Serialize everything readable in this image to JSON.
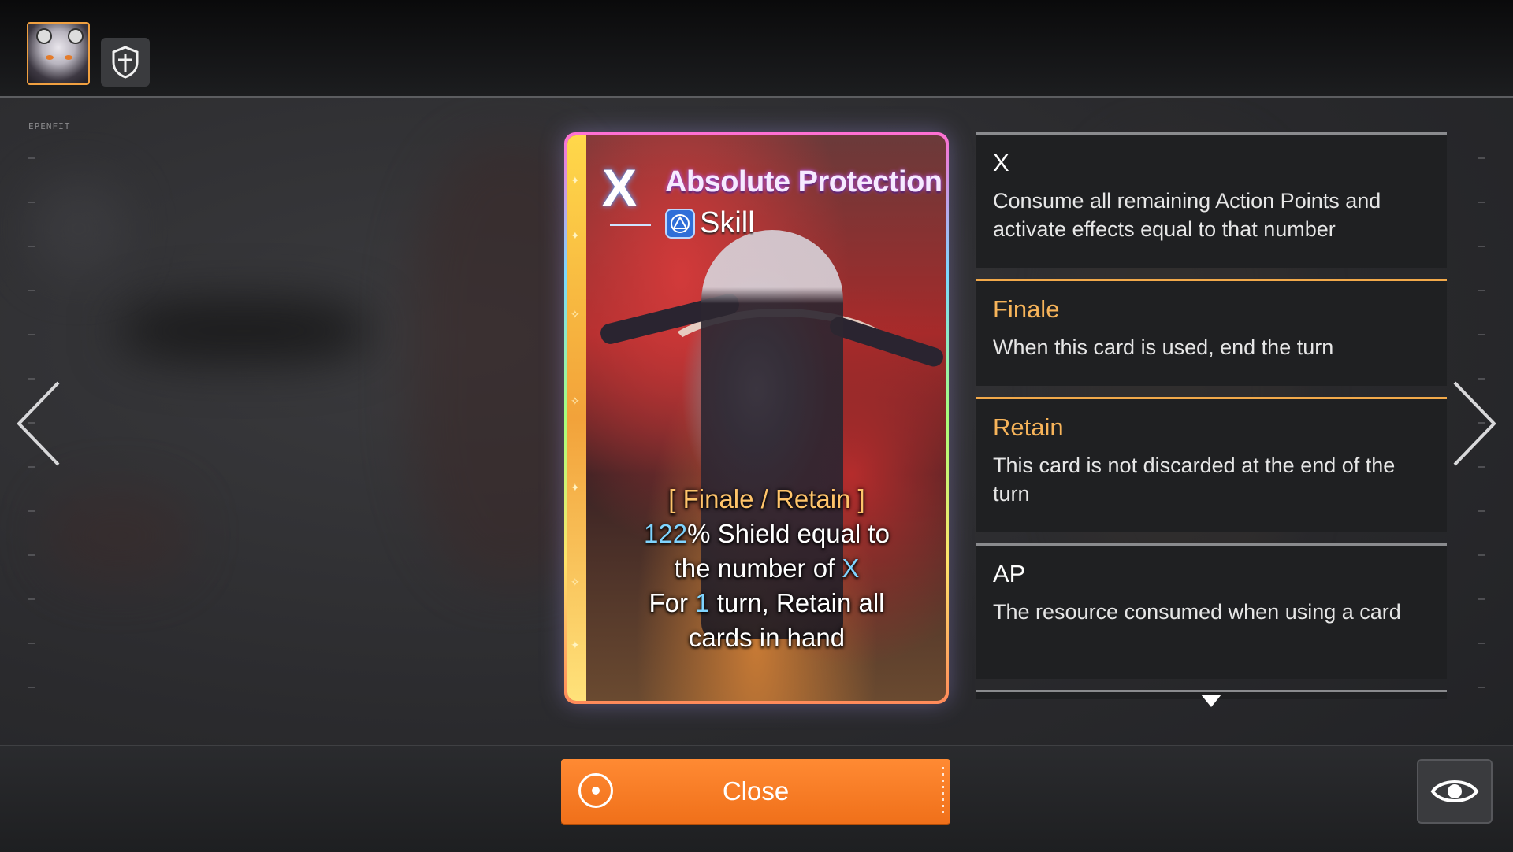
{
  "card": {
    "cost": "X",
    "title": "Absolute Protection",
    "type": "Skill",
    "keywords_line": "[ Finale / Retain ]",
    "effect": {
      "shield_pct": "122",
      "shield_text_1": "% Shield equal to",
      "shield_text_2": "the number of ",
      "shield_x": "X",
      "retain_text_1": "For ",
      "retain_turns": "1",
      "retain_text_2": " turn, Retain all",
      "retain_text_3": "cards in hand"
    }
  },
  "keywords": [
    {
      "title": "X",
      "desc": "Consume all remaining Action Points and activate effects equal to that number"
    },
    {
      "title": "Finale",
      "desc": "When this card is used, end the turn"
    },
    {
      "title": "Retain",
      "desc": "This card is not discarded at the end of the turn"
    },
    {
      "title": "AP",
      "desc": "The resource consumed when using a card"
    }
  ],
  "footer": {
    "close_label": "Close"
  },
  "side_label": "EPENFIT",
  "colors": {
    "accent": "#f0701a",
    "keyword": "#f7b45a",
    "number": "#7fd4ff"
  },
  "icons": [
    "character-avatar",
    "shield-icon",
    "skill-type-icon",
    "chevron-left-icon",
    "chevron-right-icon",
    "target-icon",
    "eye-icon",
    "scroll-down-icon"
  ]
}
